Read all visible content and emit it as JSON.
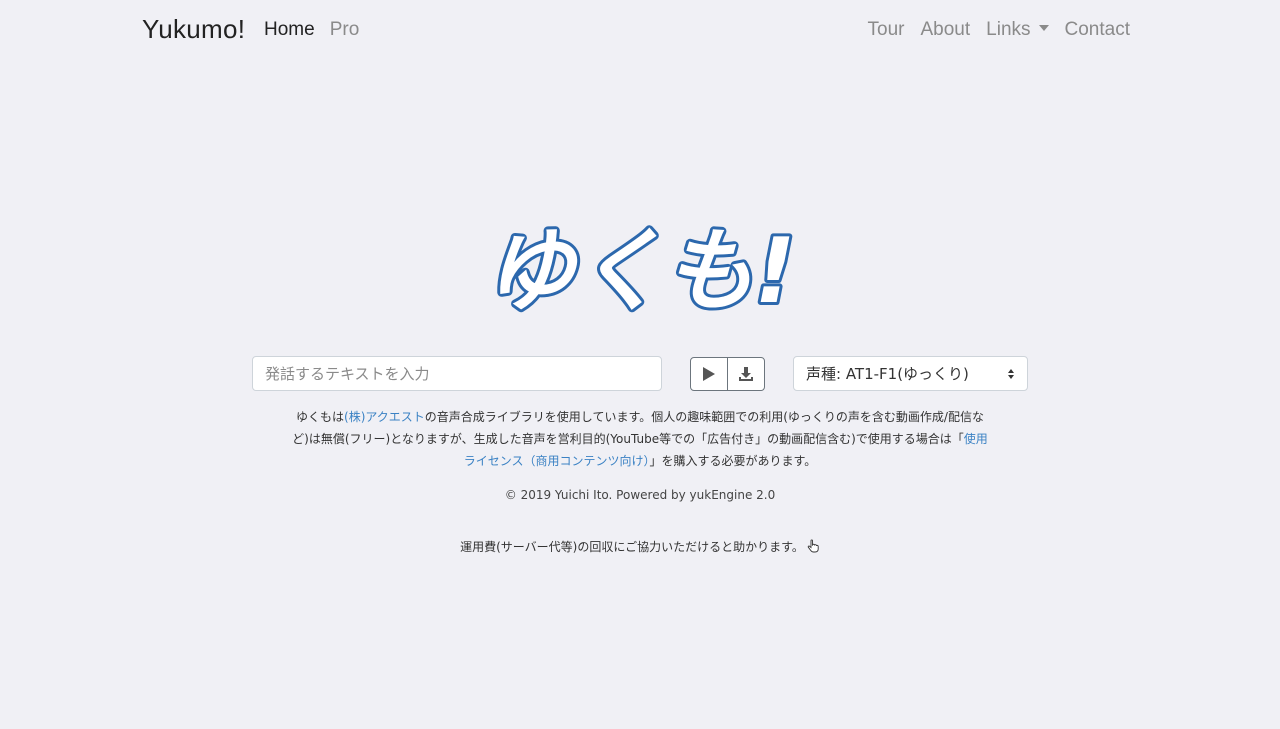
{
  "navbar": {
    "brand": "Yukumo!",
    "left_links": [
      {
        "label": "Home",
        "active": true
      },
      {
        "label": "Pro",
        "active": false
      }
    ],
    "right_links": [
      "Tour",
      "About",
      "Links",
      "Contact"
    ]
  },
  "logo": {
    "text": "ゆくも!",
    "color": "#2c68ad"
  },
  "input": {
    "placeholder": "発話するテキストを入力",
    "value": ""
  },
  "controls": {
    "play_icon": "play-icon",
    "download_icon": "download-icon"
  },
  "voice_select": {
    "selected": "声種: AT1-F1(ゆっくり)"
  },
  "info": {
    "part1": "ゆくもは",
    "link1": "(株)アクエスト",
    "part2": "の音声合成ライブラリを使用しています。個人の趣味範囲での利用(ゆっくりの声を含む動画作成/配信など)は無償(フリー)となりますが、生成した音声を営利目的(YouTube等での「広告付き」の動画配信含む)で使用する場合は「",
    "link2": "使用ライセンス（商用コンテンツ向け）",
    "part3": "」を購入する必要があります。"
  },
  "footer": {
    "copyright": "© 2019 Yuichi Ito. Powered by yukEngine 2.0",
    "donate": "運用費(サーバー代等)の回収にご協力いただけると助かります。",
    "donate_icon": "pointing-hand-icon"
  },
  "colors": {
    "background": "#f0f0f5",
    "link": "#3b82c4",
    "logo": "#2c68ad"
  }
}
